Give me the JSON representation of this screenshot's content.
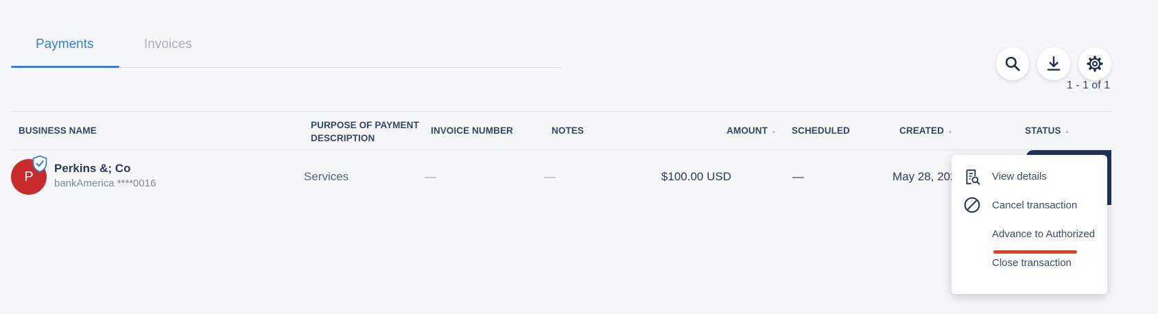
{
  "tabs": [
    {
      "label": "Payments",
      "active": true
    },
    {
      "label": "Invoices",
      "active": false
    }
  ],
  "toolbar": {
    "search_icon": "search-icon",
    "download_icon": "download-icon",
    "settings_icon": "gear-icon"
  },
  "pagination": "1 - 1 of 1",
  "table": {
    "columns": [
      {
        "label": "BUSINESS NAME"
      },
      {
        "label": "PURPOSE OF PAYMENT",
        "label_line2": "DESCRIPTION"
      },
      {
        "label": "INVOICE NUMBER"
      },
      {
        "label": "NOTES"
      },
      {
        "label": "AMOUNT",
        "sortable": true
      },
      {
        "label": "SCHEDULED"
      },
      {
        "label": "CREATED",
        "sortable": true
      },
      {
        "label": "STATUS",
        "sortable": true
      }
    ],
    "rows": [
      {
        "avatar_letter": "P",
        "business_name": "Perkins &; Co",
        "bank": "bankAmerica ****0016",
        "purpose": "Services",
        "invoice_number": "—",
        "notes": "—",
        "amount": "$100.00 USD",
        "scheduled": "—",
        "created": "May 28, 202"
      }
    ]
  },
  "menu": {
    "items": [
      {
        "label": "View details",
        "icon": "receipt-search-icon"
      },
      {
        "label": "Cancel transaction",
        "icon": "cancel-circle-icon"
      },
      {
        "label": "Advance to Authorized",
        "icon": ""
      },
      {
        "label": "Close transaction",
        "icon": ""
      }
    ]
  },
  "colors": {
    "accent": "#3b7ddd",
    "avatar": "#c72b2b",
    "status_block": "#1f3357",
    "highlight": "#e5421e"
  }
}
